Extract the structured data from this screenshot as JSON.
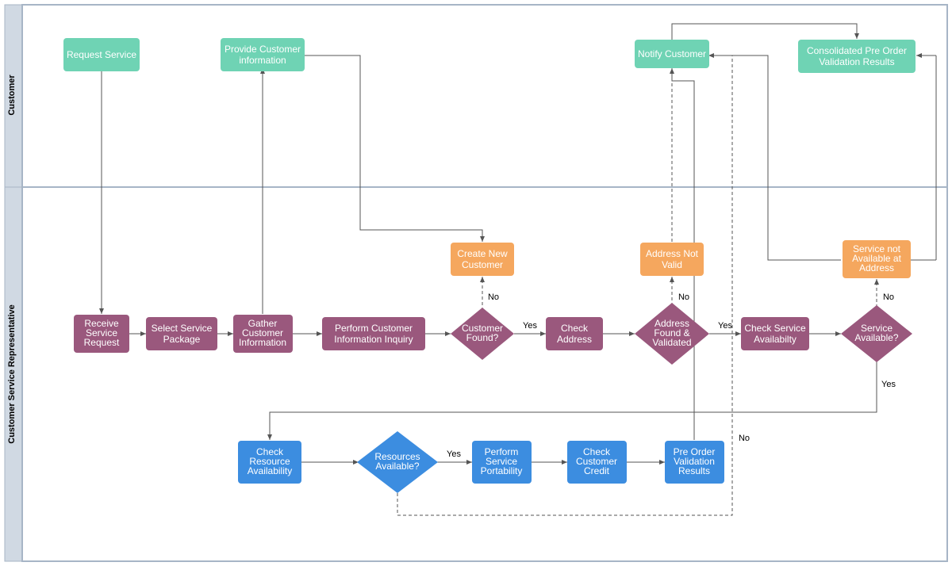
{
  "lanes": {
    "customer": "Customer",
    "csr": "Customer Service Representative"
  },
  "nodes": {
    "request_service": "Request Service",
    "provide_info_l1": "Provide Customer",
    "provide_info_l2": "information",
    "notify_customer": "Notify Customer",
    "consolidated_l1": "Consolidated Pre Order",
    "consolidated_l2": "Validation Results",
    "receive_l1": "Receive",
    "receive_l2": "Service",
    "receive_l3": "Request",
    "select_l1": "Select Service",
    "select_l2": "Package",
    "gather_l1": "Gather",
    "gather_l2": "Customer",
    "gather_l3": "Information",
    "perform_inq_l1": "Perform Customer",
    "perform_inq_l2": "Information Inquiry",
    "customer_found_l1": "Customer",
    "customer_found_l2": "Found?",
    "create_new_l1": "Create New",
    "create_new_l2": "Customer",
    "check_l1": "Check",
    "check_l2": "Address",
    "addr_found_l1": "Address",
    "addr_found_l2": "Found &",
    "addr_found_l3": "Validated",
    "addr_not_l1": "Address Not",
    "addr_not_l2": "Valid",
    "check_serv_l1": "Check Service",
    "check_serv_l2": "Availabilty",
    "serv_avail_l1": "Service",
    "serv_avail_l2": "Available?",
    "serv_not_l1": "Service not",
    "serv_not_l2": "Available at",
    "serv_not_l3": "Address",
    "check_res_l1": "Check",
    "check_res_l2": "Resource",
    "check_res_l3": "Availability",
    "res_avail_l1": "Resources",
    "res_avail_l2": "Available?",
    "perform_port_l1": "Perform",
    "perform_port_l2": "Service",
    "perform_port_l3": "Portability",
    "check_credit_l1": "Check",
    "check_credit_l2": "Customer",
    "check_credit_l3": "Credit",
    "pre_order_l1": "Pre Order",
    "pre_order_l2": "Validation",
    "pre_order_l3": "Results"
  },
  "labels": {
    "yes": "Yes",
    "no": "No"
  }
}
